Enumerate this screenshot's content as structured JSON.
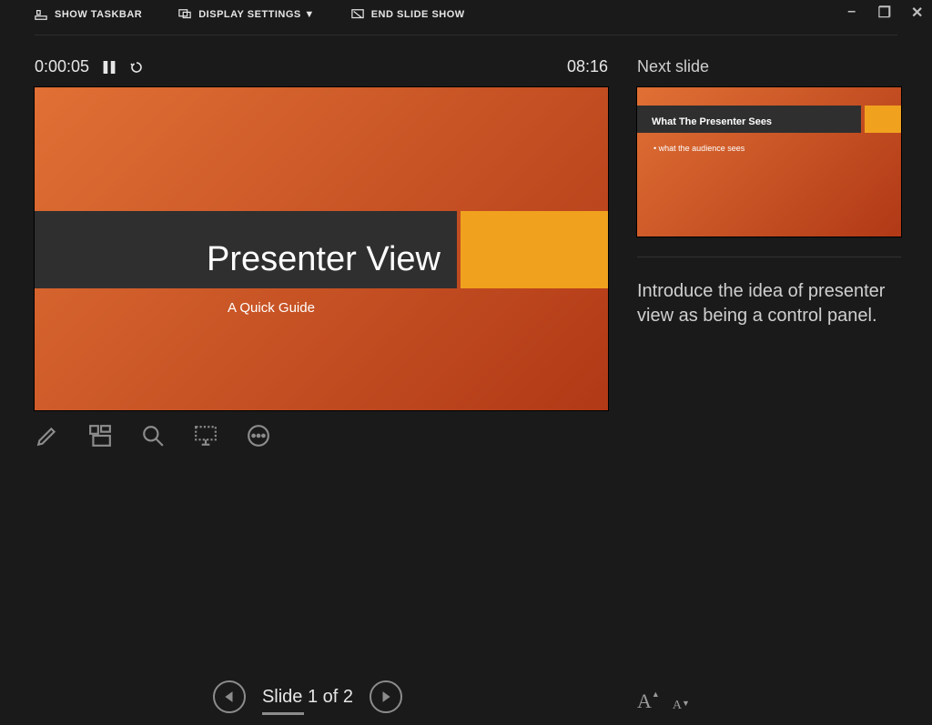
{
  "topbar": {
    "show_taskbar": "SHOW TASKBAR",
    "display_settings": "DISPLAY SETTINGS ▼",
    "end_show": "END SLIDE SHOW"
  },
  "timer": {
    "elapsed": "0:00:05",
    "clock": "08:16"
  },
  "current_slide": {
    "title": "Presenter View",
    "subtitle": "A Quick Guide"
  },
  "nav": {
    "label": "Slide 1 of 2"
  },
  "next": {
    "heading": "Next slide",
    "title": "What The Presenter Sees",
    "bullet": "• what the audience sees"
  },
  "notes": "Introduce the idea of presenter view as being a control panel."
}
